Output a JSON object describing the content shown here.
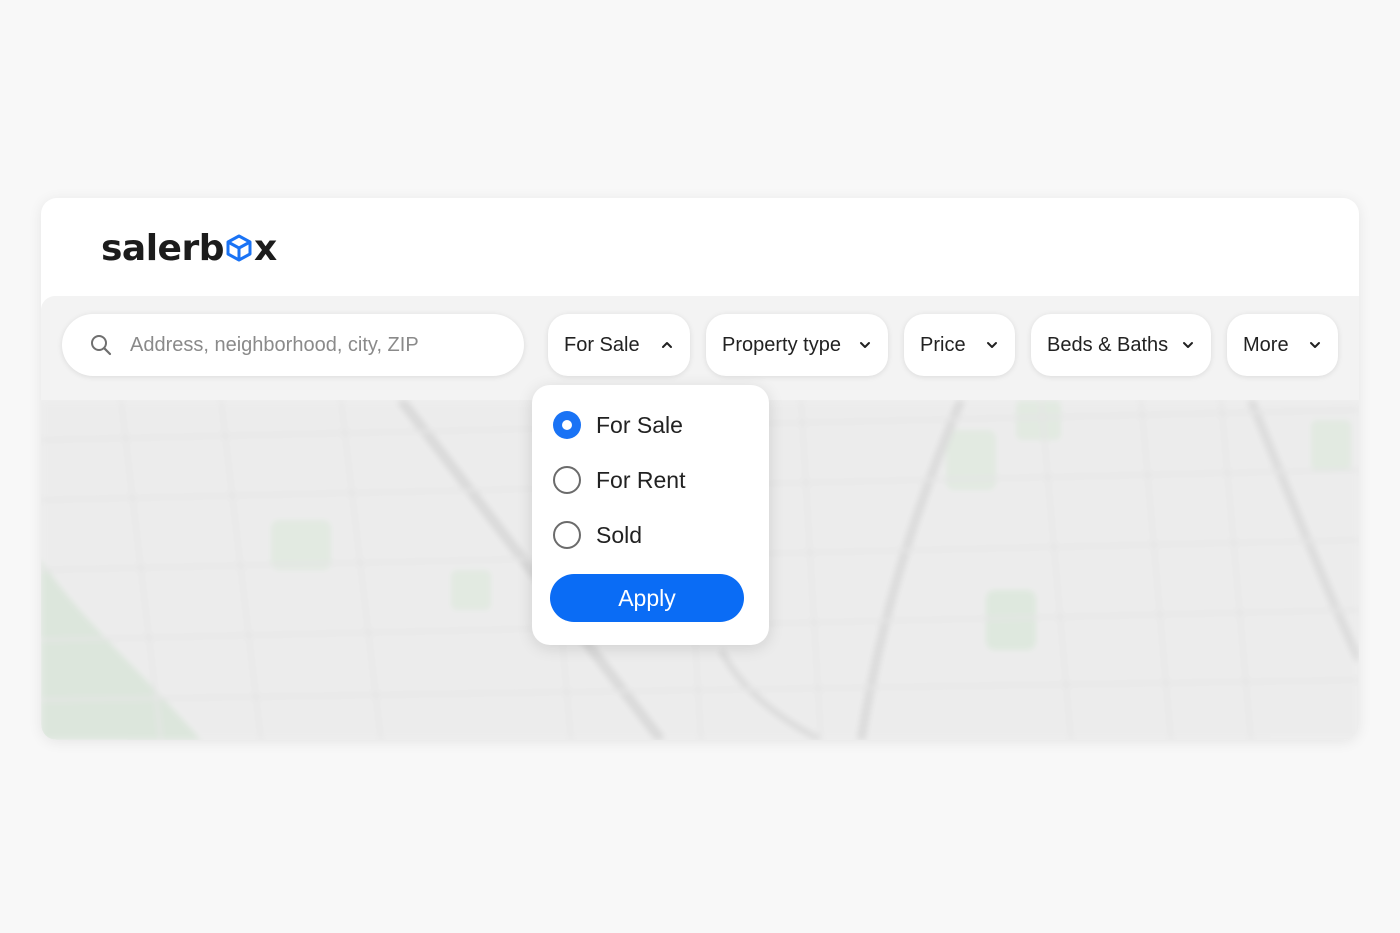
{
  "brand": {
    "name_prefix": "salerb",
    "name_suffix": "x",
    "accent_color": "#1a73f5"
  },
  "search": {
    "icon": "search-icon",
    "placeholder": "Address, neighborhood, city, ZIP",
    "value": ""
  },
  "filters": {
    "listing_type": {
      "label": "For Sale",
      "icon": "chevron-up-icon",
      "expanded": true
    },
    "property_type": {
      "label": "Property type",
      "icon": "chevron-down-icon"
    },
    "price": {
      "label": "Price",
      "icon": "chevron-down-icon"
    },
    "beds_baths": {
      "label": "Beds & Baths",
      "icon": "chevron-down-icon"
    },
    "more": {
      "label": "More",
      "icon": "chevron-down-icon"
    }
  },
  "dropdown": {
    "options": [
      {
        "label": "For Sale",
        "selected": true
      },
      {
        "label": "For Rent",
        "selected": false
      },
      {
        "label": "Sold",
        "selected": false
      }
    ],
    "apply_label": "Apply"
  }
}
